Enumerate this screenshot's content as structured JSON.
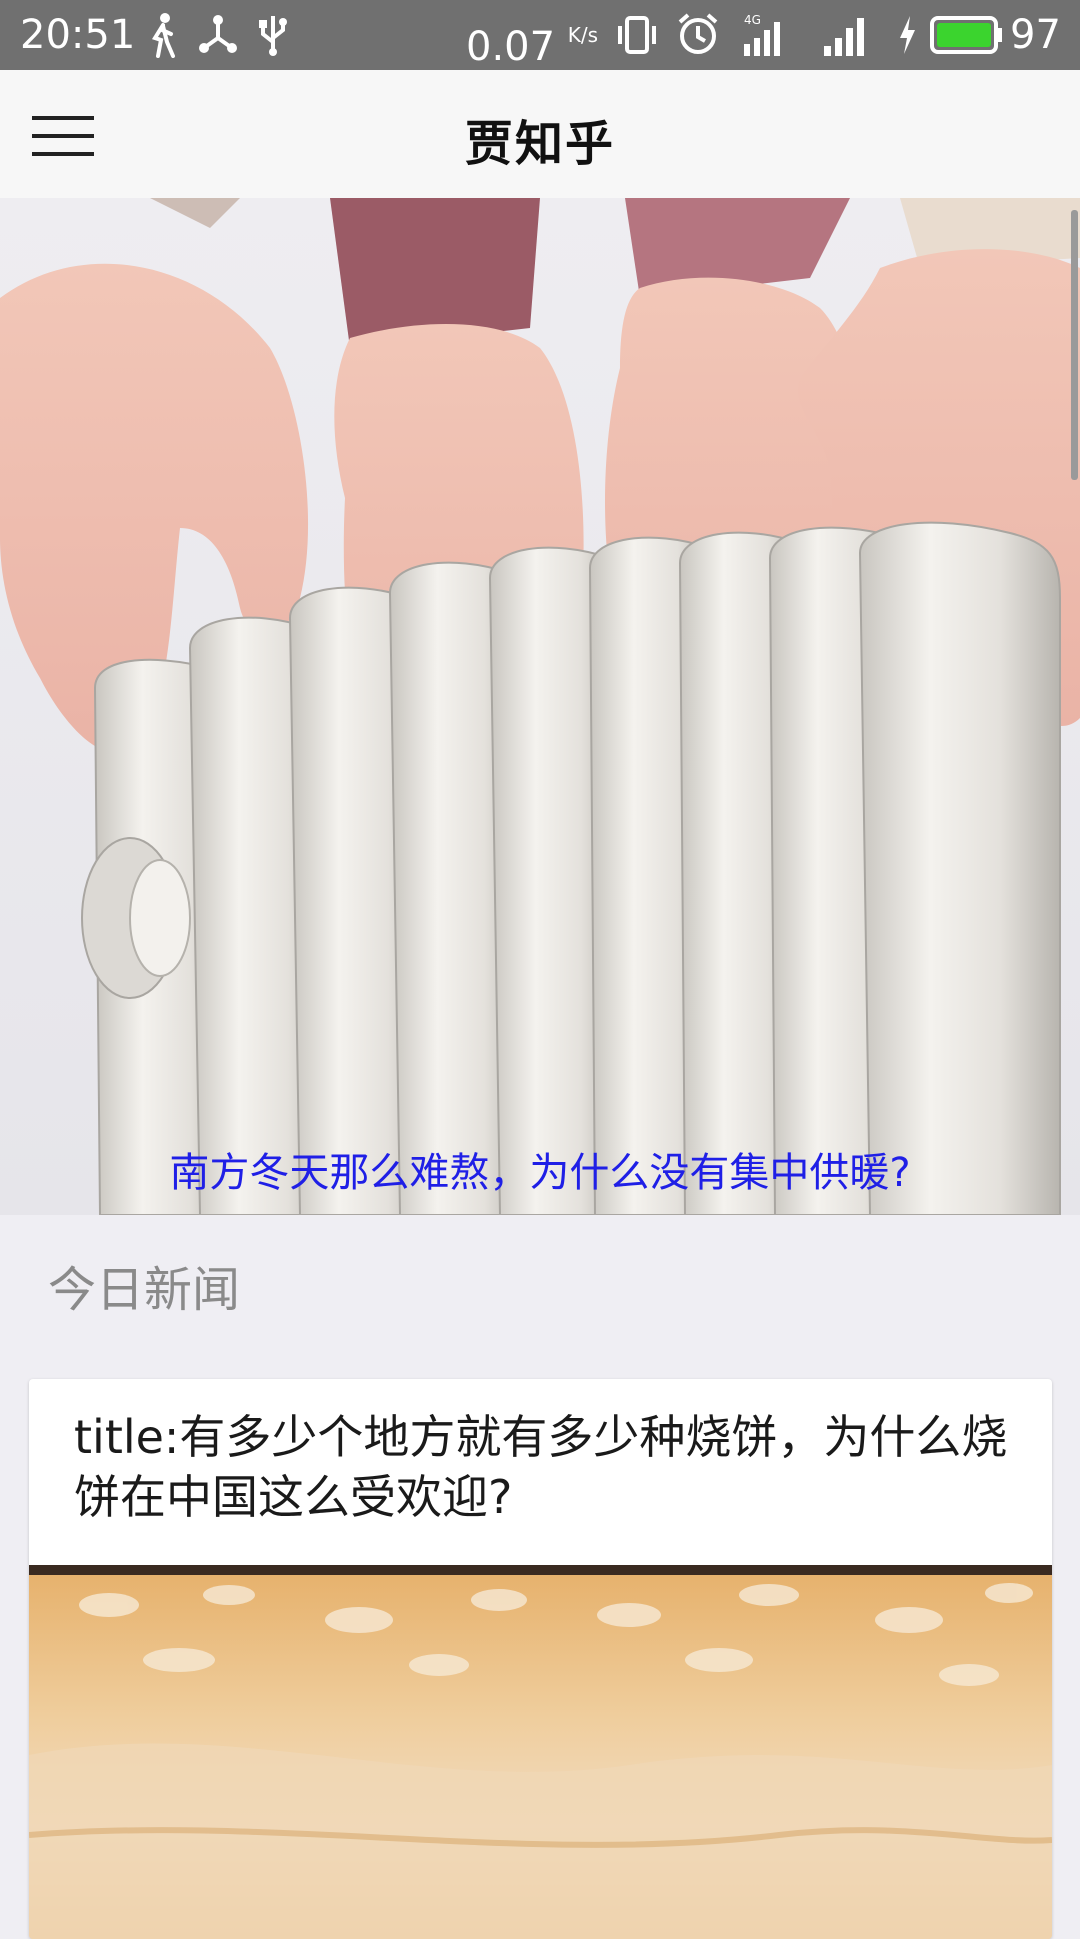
{
  "status_bar": {
    "time": "20:51",
    "net_speed": "0.07",
    "net_speed_unit": "K/s",
    "network_type": "4G",
    "battery_percent": "97",
    "icons": [
      "walking-icon",
      "share-icon",
      "usb-icon",
      "vibrate-icon",
      "alarm-icon",
      "signal-4g-icon",
      "signal-icon",
      "charging-icon",
      "battery-icon"
    ]
  },
  "toolbar": {
    "title": "贾知乎",
    "menu_icon": "hamburger-menu-icon"
  },
  "banner": {
    "image": "hands-warming-over-radiator-photo",
    "caption": "南方冬天那么难熬，为什么没有集中供暖?"
  },
  "section": {
    "title": "今日新闻"
  },
  "news": [
    {
      "title": "title:有多少个地方就有多少种烧饼，为什么烧饼在中国这么受欢迎?",
      "image": "shaobing-flatbread-photo"
    }
  ],
  "colors": {
    "status_bar_bg": "#707070",
    "toolbar_bg": "#f7f7f7",
    "caption_text": "#1f1fe6",
    "page_bg": "#efeef3",
    "section_text": "#8a8a8a"
  }
}
